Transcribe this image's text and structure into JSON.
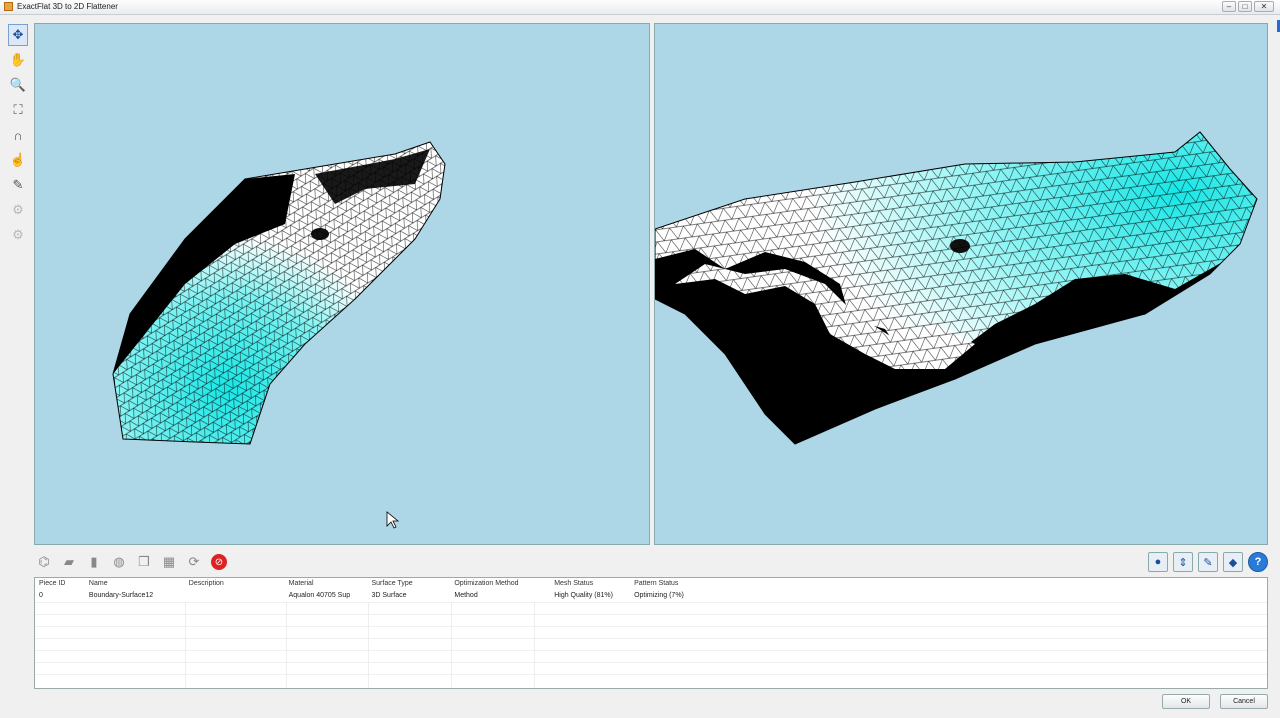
{
  "window": {
    "title": "ExactFlat 3D to 2D Flattener",
    "minimize": "–",
    "maximize": "□",
    "close": "✕"
  },
  "left_toolbar": [
    {
      "name": "rotate-tool",
      "glyph": "✥",
      "active": true
    },
    {
      "name": "pan-tool",
      "glyph": "✋",
      "active": false
    },
    {
      "name": "zoom-tool",
      "glyph": "🔍",
      "active": false
    },
    {
      "name": "zoom-extents-tool",
      "glyph": "⛶",
      "active": false
    },
    {
      "name": "magnet-tool",
      "glyph": "∩",
      "active": false
    },
    {
      "name": "grab-tool",
      "glyph": "☝",
      "active": false
    },
    {
      "name": "paint-tool",
      "glyph": "✎",
      "active": false
    },
    {
      "name": "settings-tool",
      "glyph": "⚙",
      "disabled": true
    },
    {
      "name": "settings-alt-tool",
      "glyph": "⚙",
      "disabled": true
    }
  ],
  "bottom_toolbar": [
    {
      "name": "flatten-tool",
      "glyph": "⌬"
    },
    {
      "name": "surface-tool",
      "glyph": "▰"
    },
    {
      "name": "surface-alt-tool",
      "glyph": "▮"
    },
    {
      "name": "sphere-tool",
      "glyph": "◍"
    },
    {
      "name": "layers-tool",
      "glyph": "❒"
    },
    {
      "name": "mesh-tool",
      "glyph": "▦"
    },
    {
      "name": "refresh-tool",
      "glyph": "⟳"
    }
  ],
  "stop_glyph": "⊘",
  "right_tools": [
    {
      "name": "record-tool",
      "glyph": "●"
    },
    {
      "name": "measure-tool",
      "glyph": "⇕"
    },
    {
      "name": "edit-tool",
      "glyph": "✎"
    },
    {
      "name": "color-map-tool",
      "glyph": "◆"
    },
    {
      "name": "help-tool",
      "glyph": "?"
    }
  ],
  "table": {
    "columns": [
      "Piece ID",
      "Name",
      "Description",
      "Material",
      "Surface Type",
      "Optimization Method",
      "Mesh Status",
      "Pattern Status"
    ],
    "rows": [
      [
        "0",
        "Boundary-Surface12",
        "",
        "Aqualon 40705 Sup",
        "3D Surface",
        "Method",
        "High Quality (81%)",
        "Optimizing (7%)"
      ]
    ]
  },
  "buttons": {
    "ok": "OK",
    "cancel": "Cancel"
  },
  "colors": {
    "viewport_bg": "#add6e6",
    "mesh_cyan": "#20e0e0",
    "mesh_white": "#ffffff",
    "mesh_black": "#000000"
  }
}
